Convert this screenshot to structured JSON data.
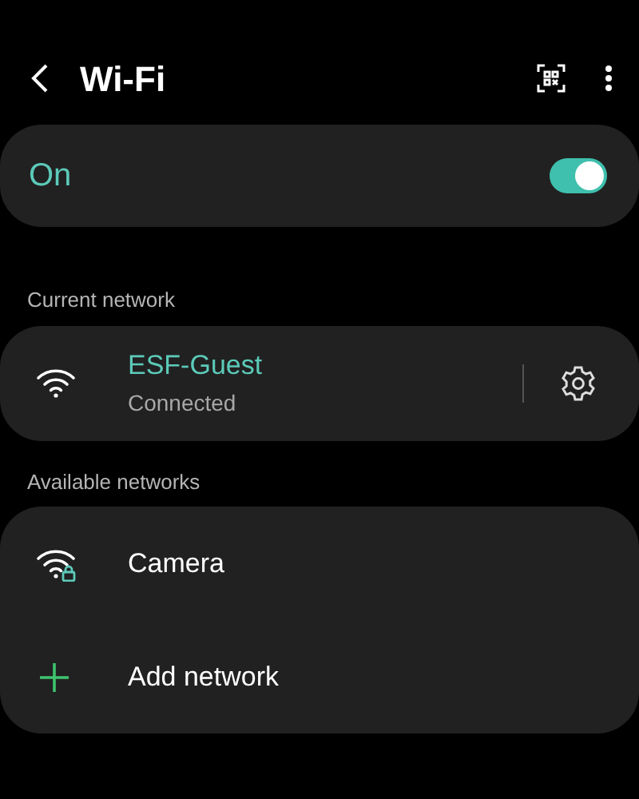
{
  "header": {
    "title": "Wi-Fi"
  },
  "master": {
    "label": "On",
    "on": true
  },
  "current": {
    "heading": "Current network",
    "networks": [
      {
        "name": "ESF-Guest",
        "status": "Connected",
        "locked": false
      }
    ]
  },
  "available": {
    "heading": "Available networks",
    "networks": [
      {
        "name": "Camera",
        "locked": true
      }
    ],
    "add_label": "Add network"
  }
}
